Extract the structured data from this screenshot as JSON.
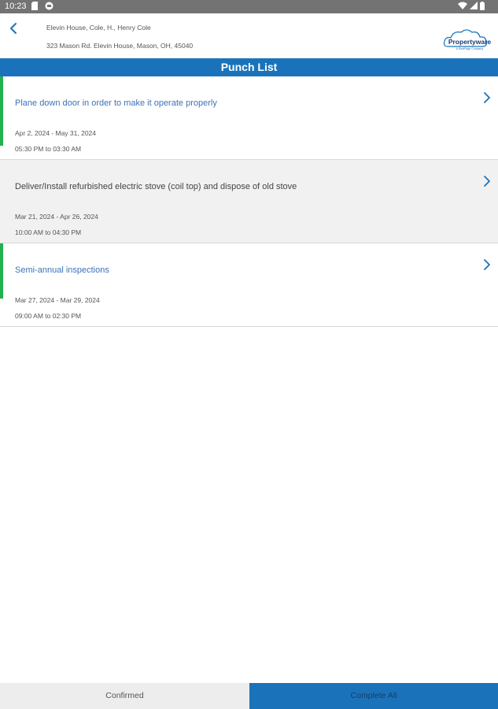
{
  "status_bar": {
    "time": "10:23"
  },
  "header": {
    "line1": "Elevin House, Cole, H., Henry Cole",
    "line2": "323 Mason Rd. Elevin House, Mason, OH, 45040",
    "logo_text": "Propertyware",
    "logo_subtext": "A RealPage Company"
  },
  "title_bar": {
    "title": "Punch List"
  },
  "items": [
    {
      "title": "Plane down door in order to make it operate properly",
      "dates": "Apr 2, 2024 - May 31, 2024",
      "time": "05:30 PM to 03:30 AM"
    },
    {
      "title": "Deliver/Install refurbished electric stove (coil top) and dispose of old stove",
      "dates": "Mar 21, 2024 - Apr 26, 2024",
      "time": "10:00 AM to 04:30 PM"
    },
    {
      "title": "Semi-annual inspections",
      "dates": "Mar 27, 2024 - Mar 29, 2024",
      "time": "09:00 AM to 02:30 PM"
    }
  ],
  "bottom": {
    "confirmed_label": "Confirmed",
    "complete_all_label": "Complete All"
  },
  "colors": {
    "accent": "#1a73ba",
    "status_green": "#22b14c",
    "link_blue": "#3d72b8"
  },
  "icons": {
    "back": "chevron-left-icon",
    "item_arrow": "chevron-right-icon",
    "wifi": "wifi-icon",
    "battery": "battery-icon"
  }
}
